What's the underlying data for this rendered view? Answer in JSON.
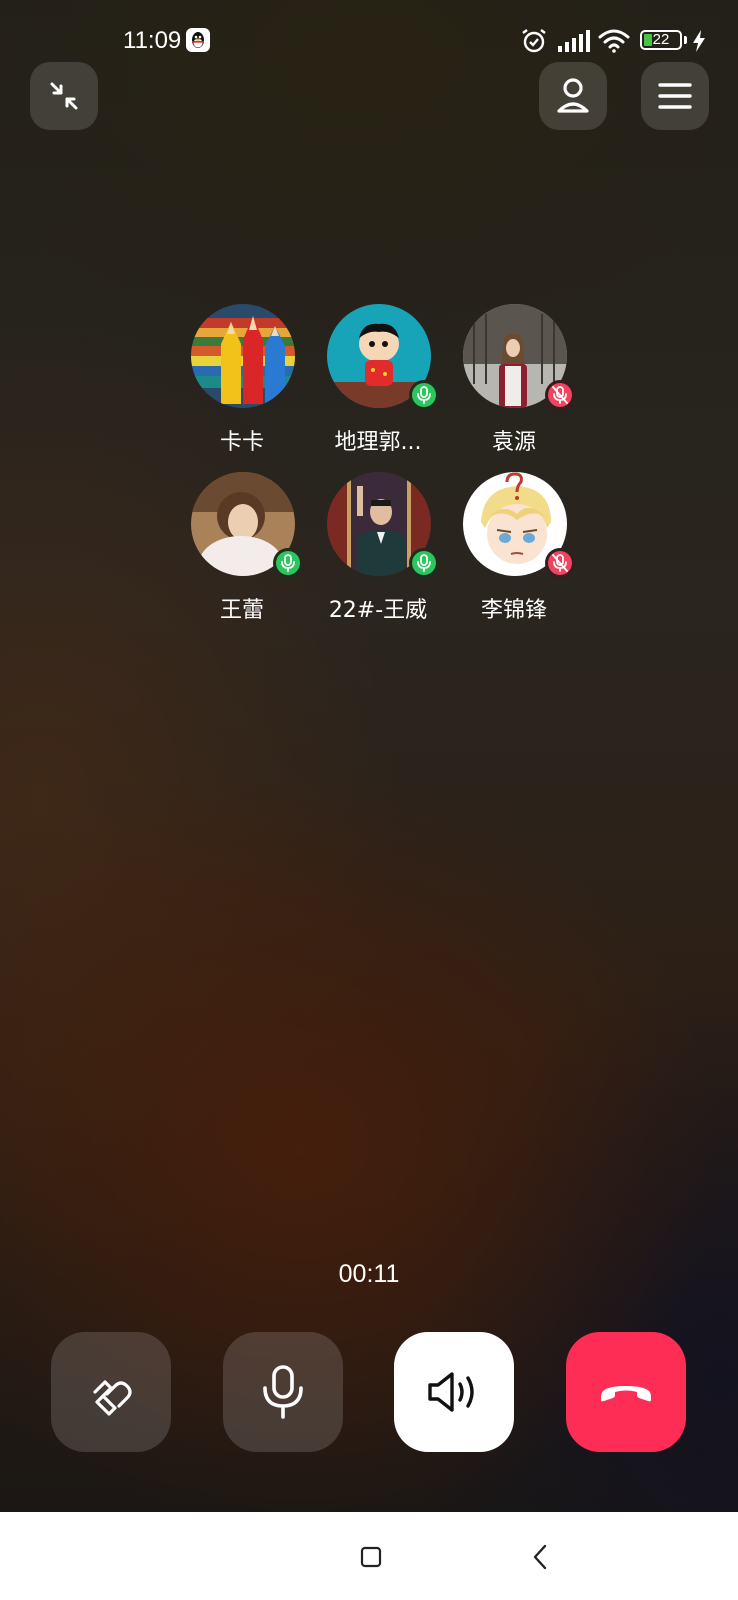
{
  "status_bar": {
    "time": "11:09",
    "battery": "22",
    "icons": [
      "qq-icon",
      "alarm-icon",
      "signal-icon",
      "wifi-icon",
      "battery-icon",
      "charging-bolt-icon"
    ]
  },
  "header": {
    "left_button_icon": "minimize-icon",
    "right_button_icons": [
      "person-icon",
      "menu-icon"
    ]
  },
  "participants": [
    {
      "name": "卡卡",
      "mic": "none",
      "avatar": "colored-pencils"
    },
    {
      "name": "地理郭...",
      "mic": "on",
      "avatar": "cartoon-boy"
    },
    {
      "name": "袁源",
      "mic": "muted",
      "avatar": "photo-woman"
    },
    {
      "name": "王蕾",
      "mic": "on",
      "avatar": "photo-child"
    },
    {
      "name": "22#-王威",
      "mic": "on",
      "avatar": "photo-man-suit"
    },
    {
      "name": "李锦锋",
      "mic": "muted",
      "avatar": "anime-blond"
    }
  ],
  "call": {
    "duration": "00:11"
  },
  "controls": [
    {
      "name": "flip-camera",
      "icon": "camera-flip-icon"
    },
    {
      "name": "mute",
      "icon": "microphone-icon"
    },
    {
      "name": "speaker",
      "icon": "speaker-icon",
      "active": true
    },
    {
      "name": "hang-up",
      "icon": "hang-up-icon"
    }
  ],
  "colors": {
    "mic_on": "#2cc55e",
    "mic_off": "#f0445e",
    "hangup": "#fe2d55",
    "battery_level": "#48c24a"
  },
  "nav_bar": {
    "icons": [
      "home-square-icon",
      "back-icon"
    ]
  }
}
